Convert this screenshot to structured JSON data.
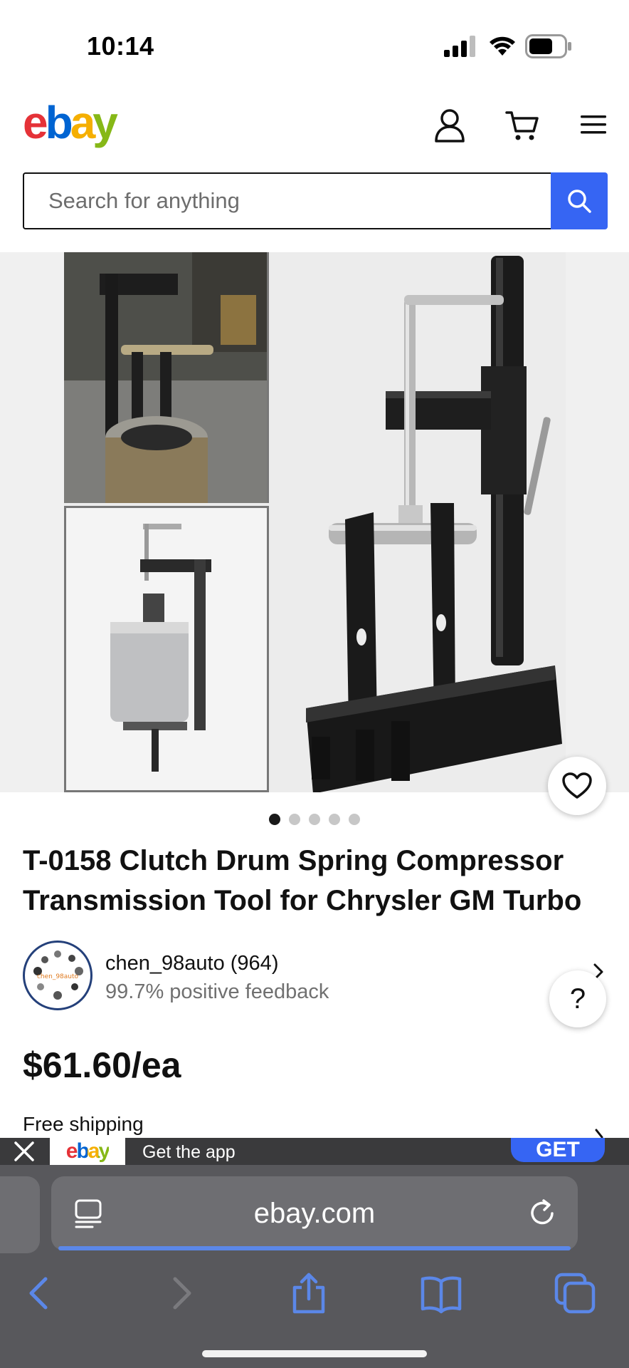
{
  "status_bar": {
    "time": "10:14"
  },
  "header": {
    "logo": {
      "e": "e",
      "b": "b",
      "a": "a",
      "y": "y"
    },
    "icons": [
      "user-icon",
      "cart-icon",
      "menu-icon"
    ]
  },
  "search": {
    "placeholder": "Search for anything"
  },
  "gallery": {
    "page_count": 5,
    "active_index": 0
  },
  "listing": {
    "title": "T-0158 Clutch Drum Spring Compressor Transmission Tool for Chrysler GM Turbo",
    "price": "$61.60/ea",
    "shipping": "Free shipping"
  },
  "seller": {
    "name": "chen_98auto (964)",
    "feedback": "99.7% positive feedback",
    "avatar_text": "chen_98auto"
  },
  "help": {
    "label": "?"
  },
  "app_banner": {
    "logo": "ebay",
    "text": "Get the app",
    "get_label": "GET"
  },
  "browser": {
    "url": "ebay.com"
  },
  "colors": {
    "brand_blue": "#3665f3",
    "ebay_red": "#e53238",
    "ebay_blue": "#0064d2",
    "ebay_yellow": "#f5af02",
    "ebay_green": "#86b817"
  }
}
